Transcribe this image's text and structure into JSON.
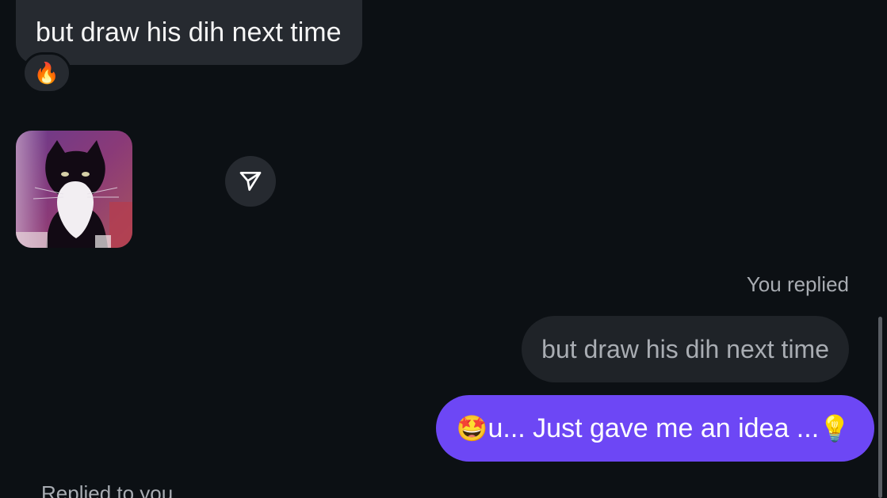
{
  "messages": {
    "incoming_text": "but draw his dih next time",
    "reaction_emoji": "🔥",
    "share_icon": "send-icon",
    "reply_label": "You replied",
    "quoted_text": "but draw his dih next time",
    "outgoing_text_emoji_start": "🤩",
    "outgoing_text": "u... Just gave me an idea ...",
    "outgoing_text_emoji_end": "💡",
    "footer_label": "Replied to you"
  },
  "colors": {
    "background": "#0c1014",
    "incoming_bubble": "#262a30",
    "outgoing_bubble": "#6d47f5",
    "quoted_bubble": "#1f2328",
    "muted_text": "#a8acb2"
  }
}
